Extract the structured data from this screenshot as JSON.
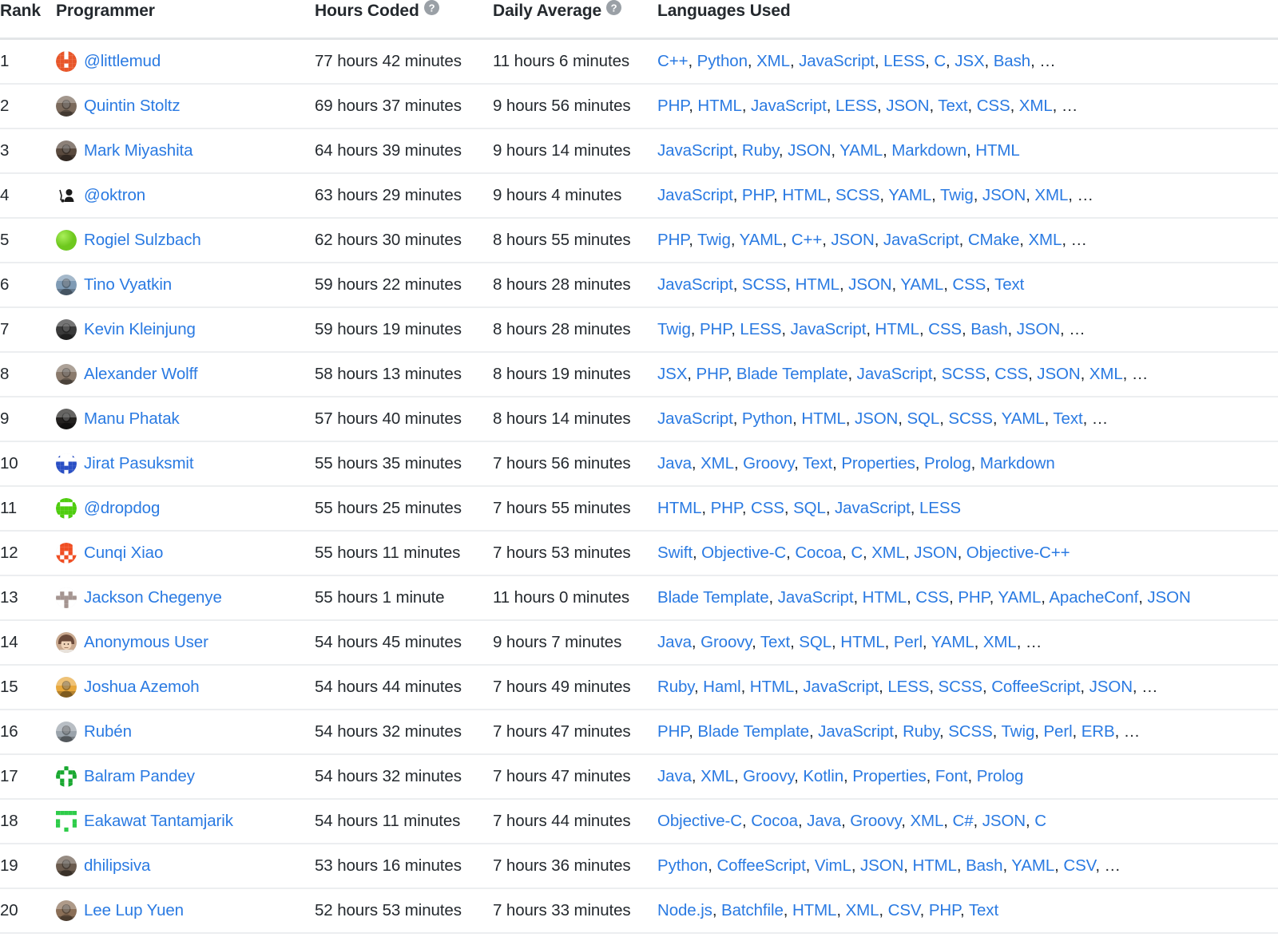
{
  "table": {
    "columns": [
      {
        "key": "rank",
        "label": "Rank",
        "help": false
      },
      {
        "key": "programmer",
        "label": "Programmer",
        "help": false
      },
      {
        "key": "hours",
        "label": "Hours Coded",
        "help": true
      },
      {
        "key": "daily",
        "label": "Daily Average",
        "help": true
      },
      {
        "key": "languages",
        "label": "Languages Used",
        "help": false
      }
    ],
    "help_icon": "question-mark-circle-icon",
    "colors": {
      "link": "#2a7ae2",
      "text": "#24292e",
      "row_border": "#eceef0",
      "header_border": "#e3e6e8",
      "help_icon_bg": "#9aa0a6"
    },
    "rows": [
      {
        "rank": "1",
        "name": "@littlemud",
        "avatar": {
          "type": "identicon",
          "color": "#e8562a",
          "shape": "grid"
        },
        "hours": "77 hours 42 minutes",
        "daily": "11 hours 6 minutes",
        "languages": [
          "C++",
          "Python",
          "XML",
          "JavaScript",
          "LESS",
          "C",
          "JSX",
          "Bash"
        ],
        "truncated": true
      },
      {
        "rank": "2",
        "name": "Quintin Stoltz",
        "avatar": {
          "type": "photo",
          "color": "#7b6a5c",
          "shape": "portrait"
        },
        "hours": "69 hours 37 minutes",
        "daily": "9 hours 56 minutes",
        "languages": [
          "PHP",
          "HTML",
          "JavaScript",
          "LESS",
          "JSON",
          "Text",
          "CSS",
          "XML"
        ],
        "truncated": true
      },
      {
        "rank": "3",
        "name": "Mark Miyashita",
        "avatar": {
          "type": "photo",
          "color": "#5a4a3e",
          "shape": "portrait"
        },
        "hours": "64 hours 39 minutes",
        "daily": "9 hours 14 minutes",
        "languages": [
          "JavaScript",
          "Ruby",
          "JSON",
          "YAML",
          "Markdown",
          "HTML"
        ],
        "truncated": false
      },
      {
        "rank": "4",
        "name": "@oktron",
        "avatar": {
          "type": "glyph",
          "color": "#1b1b1b",
          "shape": "figure"
        },
        "hours": "63 hours 29 minutes",
        "daily": "9 hours 4 minutes",
        "languages": [
          "JavaScript",
          "PHP",
          "HTML",
          "SCSS",
          "YAML",
          "Twig",
          "JSON",
          "XML"
        ],
        "truncated": true
      },
      {
        "rank": "5",
        "name": "Rogiel Sulzbach",
        "avatar": {
          "type": "solid",
          "color": "#6ec81e",
          "shape": "circle"
        },
        "hours": "62 hours 30 minutes",
        "daily": "8 hours 55 minutes",
        "languages": [
          "PHP",
          "Twig",
          "YAML",
          "C++",
          "JSON",
          "JavaScript",
          "CMake",
          "XML"
        ],
        "truncated": true
      },
      {
        "rank": "6",
        "name": "Tino Vyatkin",
        "avatar": {
          "type": "photo",
          "color": "#7f9bb5",
          "shape": "portrait"
        },
        "hours": "59 hours 22 minutes",
        "daily": "8 hours 28 minutes",
        "languages": [
          "JavaScript",
          "SCSS",
          "HTML",
          "JSON",
          "YAML",
          "CSS",
          "Text"
        ],
        "truncated": false
      },
      {
        "rank": "7",
        "name": "Kevin Kleinjung",
        "avatar": {
          "type": "photo",
          "color": "#3a3a3a",
          "shape": "portrait"
        },
        "hours": "59 hours 19 minutes",
        "daily": "8 hours 28 minutes",
        "languages": [
          "Twig",
          "PHP",
          "LESS",
          "JavaScript",
          "HTML",
          "CSS",
          "Bash",
          "JSON"
        ],
        "truncated": true
      },
      {
        "rank": "8",
        "name": "Alexander Wolff",
        "avatar": {
          "type": "photo",
          "color": "#8a7a6c",
          "shape": "portrait"
        },
        "hours": "58 hours 13 minutes",
        "daily": "8 hours 19 minutes",
        "languages": [
          "JSX",
          "PHP",
          "Blade Template",
          "JavaScript",
          "SCSS",
          "CSS",
          "JSON",
          "XML"
        ],
        "truncated": true
      },
      {
        "rank": "9",
        "name": "Manu Phatak",
        "avatar": {
          "type": "photo",
          "color": "#23211f",
          "shape": "portrait"
        },
        "hours": "57 hours 40 minutes",
        "daily": "8 hours 14 minutes",
        "languages": [
          "JavaScript",
          "Python",
          "HTML",
          "JSON",
          "SQL",
          "SCSS",
          "YAML",
          "Text"
        ],
        "truncated": true
      },
      {
        "rank": "10",
        "name": "Jirat Pasuksmit",
        "avatar": {
          "type": "identicon",
          "color": "#2a4fc4",
          "shape": "grid"
        },
        "hours": "55 hours 35 minutes",
        "daily": "7 hours 56 minutes",
        "languages": [
          "Java",
          "XML",
          "Groovy",
          "Text",
          "Properties",
          "Prolog",
          "Markdown"
        ],
        "truncated": false
      },
      {
        "rank": "11",
        "name": "@dropdog",
        "avatar": {
          "type": "identicon",
          "color": "#4ecd0e",
          "shape": "grid"
        },
        "hours": "55 hours 25 minutes",
        "daily": "7 hours 55 minutes",
        "languages": [
          "HTML",
          "PHP",
          "CSS",
          "SQL",
          "JavaScript",
          "LESS"
        ],
        "truncated": false
      },
      {
        "rank": "12",
        "name": "Cunqi Xiao",
        "avatar": {
          "type": "identicon",
          "color": "#f04e23",
          "shape": "grid"
        },
        "hours": "55 hours 11 minutes",
        "daily": "7 hours 53 minutes",
        "languages": [
          "Swift",
          "Objective-C",
          "Cocoa",
          "C",
          "XML",
          "JSON",
          "Objective-C++"
        ],
        "truncated": false
      },
      {
        "rank": "13",
        "name": "Jackson Chegenye",
        "avatar": {
          "type": "identicon",
          "color": "#a49490",
          "shape": "star"
        },
        "hours": "55 hours 1 minute",
        "daily": "11 hours 0 minutes",
        "languages": [
          "Blade Template",
          "JavaScript",
          "HTML",
          "CSS",
          "PHP",
          "YAML",
          "ApacheConf",
          "JSON"
        ],
        "truncated": false
      },
      {
        "rank": "14",
        "name": "Anonymous User",
        "avatar": {
          "type": "cartoon",
          "color": "#6b4a3a",
          "shape": "portrait"
        },
        "hours": "54 hours 45 minutes",
        "daily": "9 hours 7 minutes",
        "languages": [
          "Java",
          "Groovy",
          "Text",
          "SQL",
          "HTML",
          "Perl",
          "YAML",
          "XML"
        ],
        "truncated": true
      },
      {
        "rank": "15",
        "name": "Joshua Azemoh",
        "avatar": {
          "type": "photo",
          "color": "#e8a83c",
          "shape": "portrait"
        },
        "hours": "54 hours 44 minutes",
        "daily": "7 hours 49 minutes",
        "languages": [
          "Ruby",
          "Haml",
          "HTML",
          "JavaScript",
          "LESS",
          "SCSS",
          "CoffeeScript",
          "JSON"
        ],
        "truncated": true
      },
      {
        "rank": "16",
        "name": "Rubén",
        "avatar": {
          "type": "photo",
          "color": "#9aa3ab",
          "shape": "portrait"
        },
        "hours": "54 hours 32 minutes",
        "daily": "7 hours 47 minutes",
        "languages": [
          "PHP",
          "Blade Template",
          "JavaScript",
          "Ruby",
          "SCSS",
          "Twig",
          "Perl",
          "ERB"
        ],
        "truncated": true
      },
      {
        "rank": "17",
        "name": "Balram Pandey",
        "avatar": {
          "type": "identicon",
          "color": "#19a830",
          "shape": "star"
        },
        "hours": "54 hours 32 minutes",
        "daily": "7 hours 47 minutes",
        "languages": [
          "Java",
          "XML",
          "Groovy",
          "Kotlin",
          "Properties",
          "Font",
          "Prolog"
        ],
        "truncated": false
      },
      {
        "rank": "18",
        "name": "Eakawat Tantamjarik",
        "avatar": {
          "type": "identicon",
          "color": "#2ecc4a",
          "shape": "sparse"
        },
        "hours": "54 hours 11 minutes",
        "daily": "7 hours 44 minutes",
        "languages": [
          "Objective-C",
          "Cocoa",
          "Java",
          "Groovy",
          "XML",
          "C#",
          "JSON",
          "C"
        ],
        "truncated": false
      },
      {
        "rank": "19",
        "name": "dhilipsiva",
        "avatar": {
          "type": "photo",
          "color": "#6b5b4e",
          "shape": "portrait"
        },
        "hours": "53 hours 16 minutes",
        "daily": "7 hours 36 minutes",
        "languages": [
          "Python",
          "CoffeeScript",
          "VimL",
          "JSON",
          "HTML",
          "Bash",
          "YAML",
          "CSV"
        ],
        "truncated": true
      },
      {
        "rank": "20",
        "name": "Lee Lup Yuen",
        "avatar": {
          "type": "photo",
          "color": "#8b6f57",
          "shape": "portrait"
        },
        "hours": "52 hours 53 minutes",
        "daily": "7 hours 33 minutes",
        "languages": [
          "Node.js",
          "Batchfile",
          "HTML",
          "XML",
          "CSV",
          "PHP",
          "Text"
        ],
        "truncated": false
      }
    ]
  }
}
